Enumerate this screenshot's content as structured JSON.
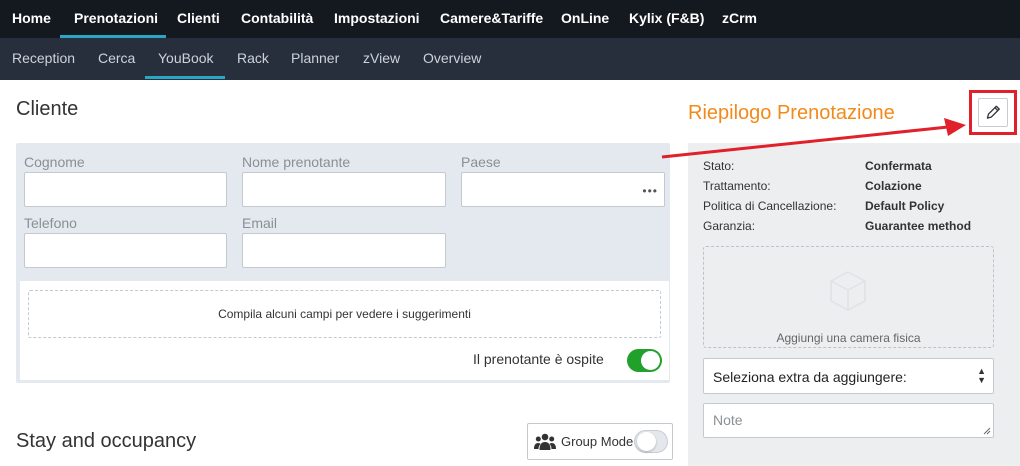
{
  "topnav": {
    "items": [
      "Home",
      "Prenotazioni",
      "Clienti",
      "Contabilità",
      "Impostazioni",
      "Camere&Tariffe",
      "OnLine",
      "Kylix (F&B)",
      "zCrm"
    ],
    "active": "Prenotazioni"
  },
  "subnav": {
    "items": [
      "Reception",
      "Cerca",
      "YouBook",
      "Rack",
      "Planner",
      "zView",
      "Overview"
    ],
    "active": "YouBook"
  },
  "cliente": {
    "title": "Cliente",
    "labels": {
      "cognome": "Cognome",
      "nome": "Nome prenotante",
      "paese": "Paese",
      "telefono": "Telefono",
      "email": "Email"
    },
    "paese_button": "•••",
    "suggestions_text": "Compila alcuni campi per vedere i suggerimenti",
    "guest_toggle_label": "Il prenotante è ospite",
    "guest_toggle_on": true
  },
  "stay": {
    "title": "Stay and occupancy",
    "group_mode_label": "Group Mode",
    "group_mode_on": false
  },
  "riepilogo": {
    "title": "Riepilogo Prenotazione",
    "edit_icon": "pencil-icon",
    "rows": [
      {
        "key": "Stato:",
        "value": "Confermata"
      },
      {
        "key": "Trattamento:",
        "value": "Colazione"
      },
      {
        "key": "Politica di Cancellazione:",
        "value": "Default Policy"
      },
      {
        "key": "Garanzia:",
        "value": "Guarantee method"
      }
    ],
    "room_placeholder": "Aggiungi una camera fisica",
    "extra_select": "Seleziona extra da aggiungere:",
    "notes_placeholder": "Note"
  },
  "colors": {
    "topnav_bg": "#14181f",
    "subnav_bg": "#262f3b",
    "accent": "#2aa5c4",
    "riepilogo_title": "#f28a1a",
    "toggle_on": "#22a02c",
    "annotation_red": "#e0202a"
  }
}
